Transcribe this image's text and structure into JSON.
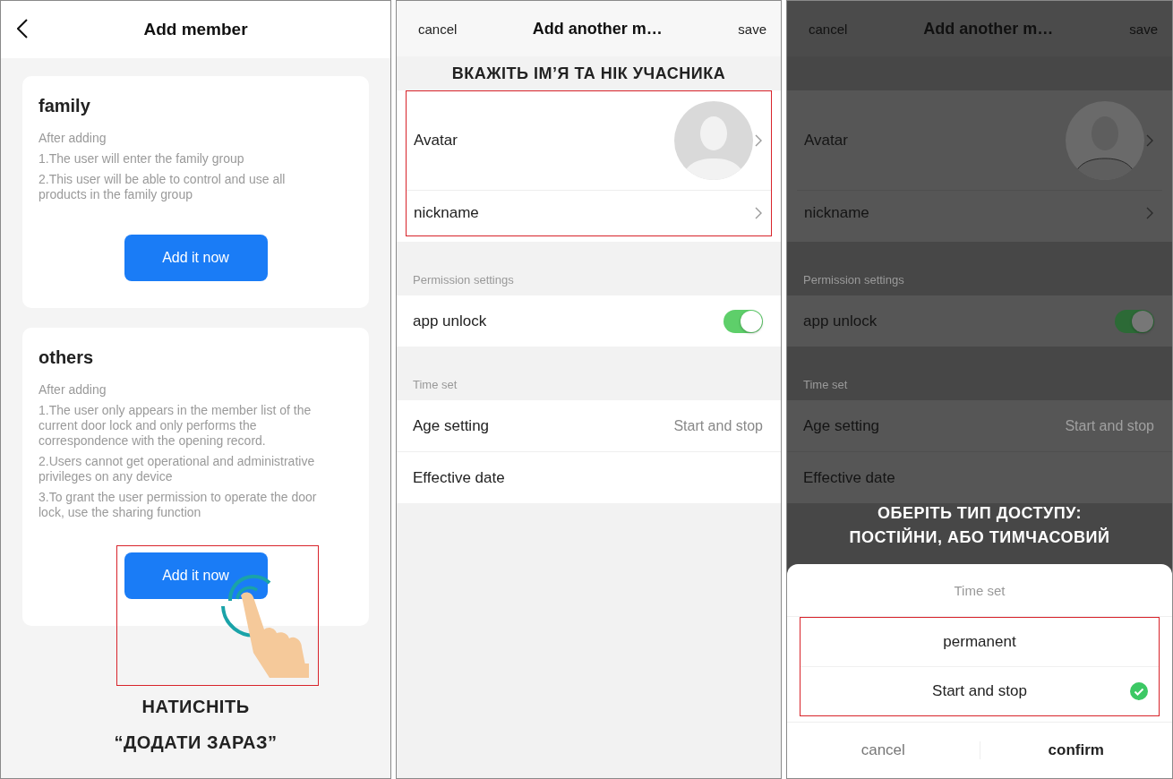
{
  "add_member_screen": {
    "title": "Add member",
    "cards": [
      {
        "title": "family",
        "lines": [
          "After adding",
          "1.The user will enter the family group",
          "2.This user will be able to control and use all products in the family group"
        ],
        "button": "Add it now",
        "highlighted": false
      },
      {
        "title": "others",
        "lines": [
          "After adding",
          "1.The user only appears in the member list of the current door lock and only performs the correspondence with the opening record.",
          "2.Users cannot get operational and administrative privileges on any device",
          "3.To grant the user permission to operate the door lock, use the sharing function"
        ],
        "button": "Add it now",
        "highlighted": true
      }
    ],
    "caption": [
      "НАТИСНІТЬ",
      "“ДОДАТИ ЗАРАЗ”"
    ]
  },
  "member_form_screen": {
    "cancel": "cancel",
    "title": "Add another m…",
    "save": "save",
    "caption": "ВКАЖІТЬ ІМ’Я ТА НІК УЧАСНИКА",
    "highlighted": true,
    "profile_rows": [
      {
        "kind": "avatar",
        "label": "Avatar"
      },
      {
        "kind": "link",
        "label": "nickname"
      }
    ],
    "sections": [
      {
        "header": "Permission settings",
        "rows": [
          {
            "kind": "toggle",
            "label": "app unlock",
            "on": true
          }
        ]
      },
      {
        "header": "Time set",
        "rows": [
          {
            "kind": "value",
            "label": "Age setting",
            "value": "Start and stop"
          },
          {
            "kind": "plain",
            "label": "Effective date"
          }
        ]
      }
    ]
  },
  "time_set_screen": {
    "cancel": "cancel",
    "title": "Add another m…",
    "save": "save",
    "profile_rows": [
      {
        "kind": "avatar",
        "label": "Avatar"
      },
      {
        "kind": "link",
        "label": "nickname"
      }
    ],
    "sections": [
      {
        "header": "Permission settings",
        "rows": [
          {
            "kind": "toggle",
            "label": "app unlock",
            "on": true
          }
        ]
      },
      {
        "header": "Time set",
        "rows": [
          {
            "kind": "value",
            "label": "Age setting",
            "value": "Start and stop"
          },
          {
            "kind": "plain",
            "label": "Effective date"
          }
        ]
      }
    ],
    "caption": [
      "ОБЕРІТЬ ТИП ДОСТУПУ:",
      "ПОСТІЙНИ, АБО ТИМЧАСОВИЙ"
    ],
    "sheet": {
      "title": "Time set",
      "options": [
        {
          "label": "permanent",
          "selected": false
        },
        {
          "label": "Start and stop",
          "selected": true
        }
      ],
      "highlighted": true,
      "cancel": "cancel",
      "confirm": "confirm"
    }
  }
}
